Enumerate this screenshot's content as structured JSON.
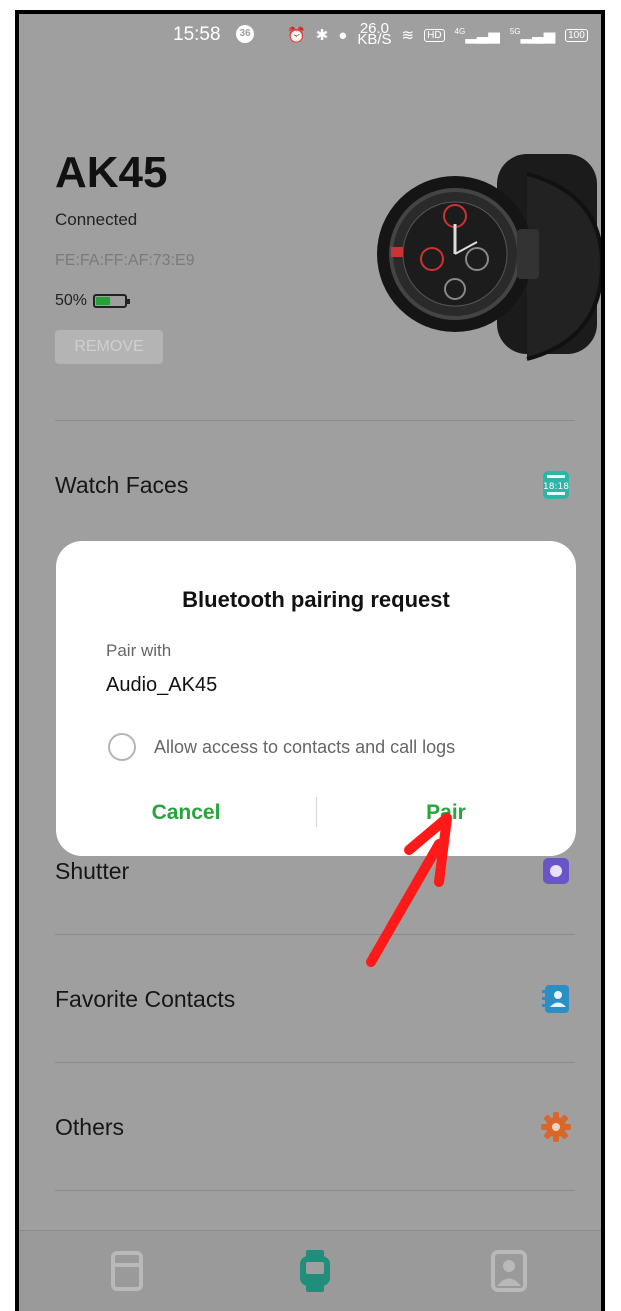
{
  "status_bar": {
    "time": "15:58",
    "notification_count": "36",
    "net_speed_value": "26.0",
    "net_speed_unit": "KB/S",
    "hd_label": "HD",
    "sim1_label": "4G",
    "sim2_label": "5G",
    "battery_level": "100"
  },
  "device": {
    "name": "AK45",
    "status": "Connected",
    "mac": "FE:FA:FF:AF:73:E9",
    "battery_text": "50%",
    "battery_fraction": 0.5,
    "battery_color": "#23a23a",
    "remove_label": "REMOVE"
  },
  "menu": {
    "watch_faces": "Watch Faces",
    "shutter": "Shutter",
    "favorite_contacts": "Favorite Contacts",
    "others": "Others"
  },
  "dialog": {
    "title": "Bluetooth pairing request",
    "pair_with_label": "Pair with",
    "device_name": "Audio_AK45",
    "checkbox_label": "Allow access to contacts and call logs",
    "cancel_label": "Cancel",
    "pair_label": "Pair",
    "accent_color": "#27a53b"
  },
  "icons": {
    "watch_faces": "watch-face-icon",
    "shutter": "camera-icon",
    "favorite_contacts": "contacts-book-icon",
    "others": "gear-icon",
    "nav_left": "card-icon",
    "nav_center": "watch-icon",
    "nav_right": "profile-icon"
  },
  "annotation": {
    "arrow_color": "#ff1a1a"
  }
}
